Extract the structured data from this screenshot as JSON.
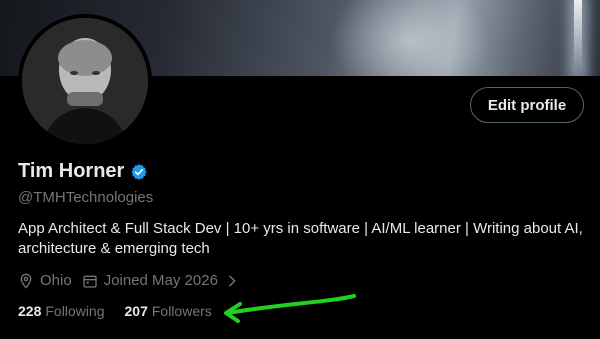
{
  "profile": {
    "name": "Tim Horner",
    "handle": "@TMHTechnologies",
    "bio": "App Architect & Full Stack Dev | 10+ yrs in software | AI/ML learner | Writing about AI, architecture & emerging tech",
    "location": "Ohio",
    "joined": "Joined May 2026",
    "edit_label": "Edit profile",
    "verified_color": "#1d9bf0"
  },
  "stats": {
    "following_count": "228",
    "following_label": "Following",
    "followers_count": "207",
    "followers_label": "Followers"
  },
  "icons": {
    "location": "location-pin-icon",
    "calendar": "calendar-icon",
    "chevron": "chevron-right-icon",
    "verified": "verified-badge-icon"
  },
  "annotation": {
    "arrow_color": "#22d022"
  }
}
